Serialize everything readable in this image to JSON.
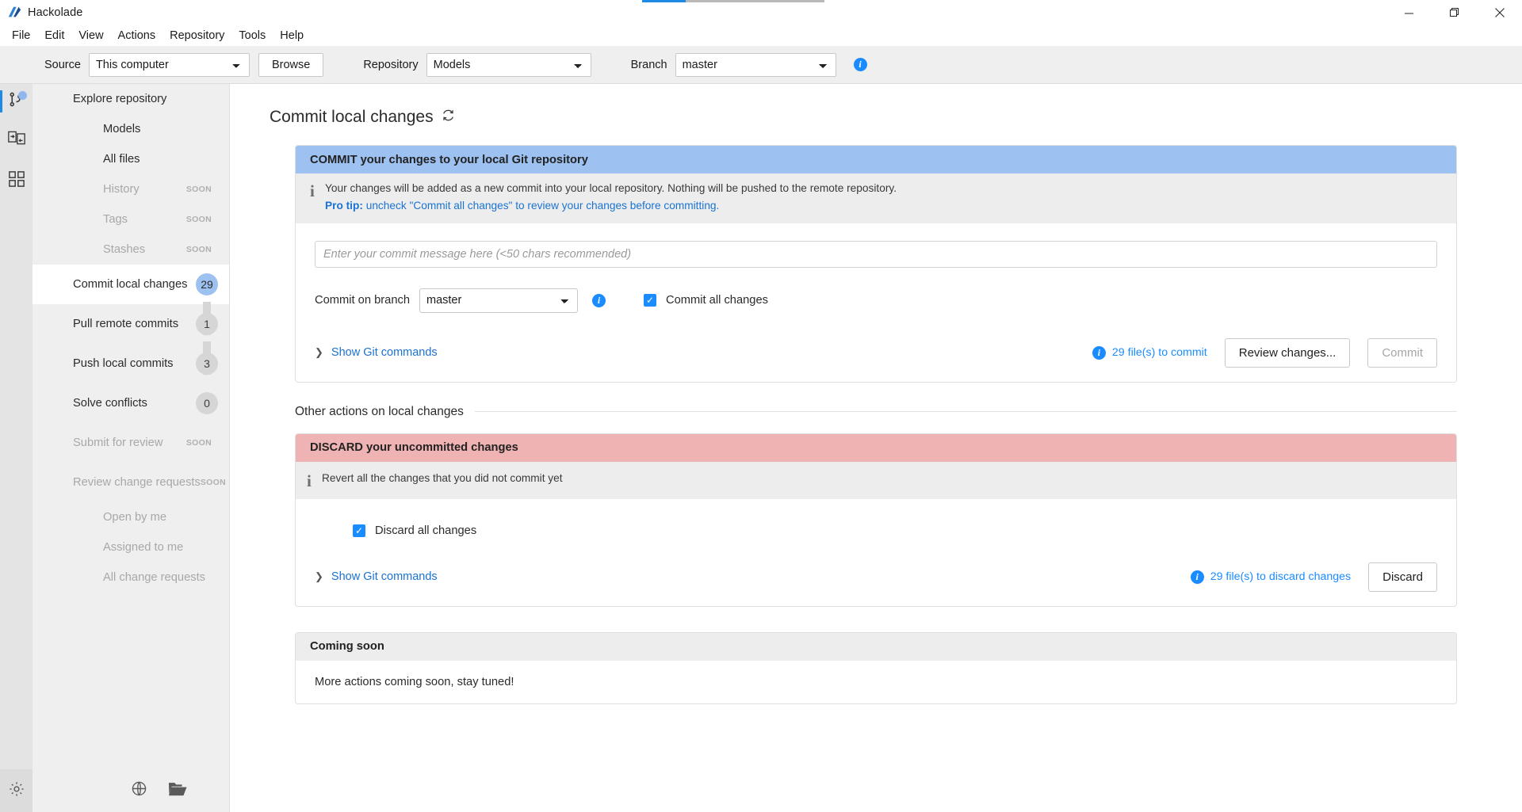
{
  "window": {
    "title": "Hackolade",
    "logo_icon": "hackolade-logo-icon",
    "minimize_icon": "minimize-icon",
    "maximize_icon": "maximize-icon",
    "close_icon": "close-icon",
    "accent_colors": [
      "#1e8ae6",
      "#b9b9b9"
    ]
  },
  "menubar": {
    "items": [
      {
        "label": "File"
      },
      {
        "label": "Edit"
      },
      {
        "label": "View"
      },
      {
        "label": "Actions"
      },
      {
        "label": "Repository"
      },
      {
        "label": "Tools"
      },
      {
        "label": "Help"
      }
    ]
  },
  "toolbar": {
    "rail_icon": "curly-braces-icon",
    "source_label": "Source",
    "source_value": "This computer",
    "source_options": [
      "This computer"
    ],
    "browse_label": "Browse",
    "repository_label": "Repository",
    "repository_value": "Models",
    "repository_options": [
      "Models"
    ],
    "branch_label": "Branch",
    "branch_value": "master",
    "branch_options": [
      "master"
    ],
    "info_icon": "info-icon"
  },
  "rail": {
    "items": [
      {
        "icon": "git-branch-icon",
        "active": true,
        "badge": true
      },
      {
        "icon": "transfer-icon",
        "active": false,
        "badge": false
      },
      {
        "icon": "grid-icon",
        "active": false,
        "badge": false
      }
    ],
    "settings_icon": "gear-icon"
  },
  "sidebar": {
    "items": [
      {
        "label": "Explore repository",
        "level": "head",
        "state": "normal",
        "badge": null
      },
      {
        "label": "Models",
        "level": "sub",
        "state": "normal",
        "badge": null
      },
      {
        "label": "All files",
        "level": "sub",
        "state": "normal",
        "badge": null
      },
      {
        "label": "History",
        "level": "sub",
        "state": "disabled",
        "badge": "SOON"
      },
      {
        "label": "Tags",
        "level": "sub",
        "state": "disabled",
        "badge": "SOON"
      },
      {
        "label": "Stashes",
        "level": "sub",
        "state": "disabled",
        "badge": "SOON"
      },
      {
        "label": "Commit local changes",
        "level": "head",
        "state": "selected",
        "badge": "29"
      },
      {
        "label": "Pull remote commits",
        "level": "head",
        "state": "normal",
        "badge": "1"
      },
      {
        "label": "Push local commits",
        "level": "head",
        "state": "normal",
        "badge": "3"
      },
      {
        "label": "Solve conflicts",
        "level": "head",
        "state": "normal",
        "badge": "0"
      },
      {
        "label": "Submit for review",
        "level": "head",
        "state": "disabled",
        "badge": "SOON"
      },
      {
        "label": "Review change requests",
        "level": "head",
        "state": "disabled",
        "badge": "SOON"
      },
      {
        "label": "Open by me",
        "level": "sub",
        "state": "disabled",
        "badge": null
      },
      {
        "label": "Assigned to me",
        "level": "sub",
        "state": "disabled",
        "badge": null
      },
      {
        "label": "All change requests",
        "level": "sub",
        "state": "disabled",
        "badge": null
      }
    ],
    "bottom_icons": [
      {
        "icon": "globe-icon"
      },
      {
        "icon": "folder-open-icon"
      }
    ]
  },
  "main": {
    "page_title": "Commit local changes",
    "refresh_icon": "refresh-icon",
    "commit_card": {
      "header": "COMMIT your changes to your local Git repository",
      "info_icon": "info-i-icon",
      "info_line": "Your changes will be added as a new commit into your local repository. Nothing will be pushed to the remote repository.",
      "protip_bold": "Pro tip:",
      "protip_rest": " uncheck \"Commit all changes\" to review your changes before committing.",
      "message_placeholder": "Enter your commit message here (<50 chars recommended)",
      "message_value": "",
      "branch_label": "Commit on branch",
      "branch_value": "master",
      "branch_options": [
        "master"
      ],
      "branch_info_icon": "info-icon",
      "checkbox_label": "Commit all changes",
      "checkbox_checked": true,
      "show_git_commands": "Show Git commands",
      "chevron_icon": "chevron-right-icon",
      "file_count_text": "29 file(s) to commit",
      "file_count_icon": "info-icon",
      "review_button": "Review changes...",
      "commit_button": "Commit",
      "commit_button_disabled": true
    },
    "other_actions_title": "Other actions on local changes",
    "discard_card": {
      "header": "DISCARD your uncommitted changes",
      "info_icon": "info-i-icon",
      "info_line": "Revert all the changes that you did not commit yet",
      "checkbox_label": "Discard all changes",
      "checkbox_checked": true,
      "show_git_commands": "Show Git commands",
      "chevron_icon": "chevron-right-icon",
      "file_count_text": "29 file(s) to discard changes",
      "file_count_icon": "info-icon",
      "discard_button": "Discard"
    },
    "coming_soon_card": {
      "header": "Coming soon",
      "body": "More actions coming soon, stay tuned!"
    }
  },
  "colors": {
    "accent_blue": "#1a8cff",
    "commit_header": "#9dc1f0",
    "discard_header": "#f0b3b3",
    "link_blue": "#1a73d2"
  }
}
